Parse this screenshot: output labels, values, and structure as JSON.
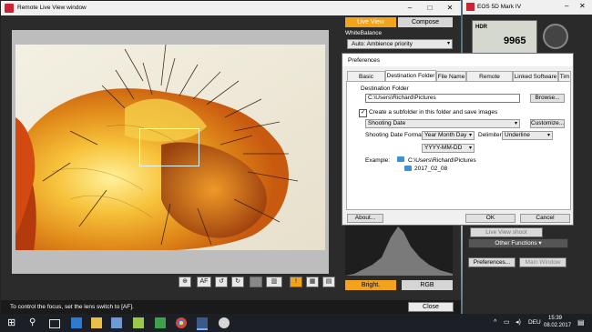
{
  "liveview": {
    "title": "Remote Live View window",
    "tab_liveview": "Live View",
    "tab_compose": "Compose",
    "whitebalance_label": "WhiteBalance",
    "whitebalance_value": "Auto: Ambience priority",
    "toolbar_labels": [
      "⊕",
      "AF",
      "↺",
      "↻",
      "",
      "▥",
      "!",
      "▦",
      "▤"
    ],
    "btn_bright": "Bright.",
    "btn_rgb": "RGB",
    "status_msg": "To control the focus, set the lens switch to [AF].",
    "close_label": "Close"
  },
  "eos": {
    "title": "EOS 5D Mark IV",
    "lcd_mode": "HDR",
    "lcd_value": "9965",
    "live_view_shoot": "Live View shoot",
    "other_functions": "Other Functions",
    "preferences_btn": "Preferences...",
    "main_window_btn": "Main Window"
  },
  "prefs": {
    "title": "Preferences",
    "tabs": [
      "Basic Settings",
      "Destination Folder",
      "File Name",
      "Remote Shooting",
      "Linked Software",
      "Tim"
    ],
    "dest_label": "Destination Folder",
    "dest_value": "C:\\Users\\Richard\\Pictures",
    "browse": "Browse...",
    "subfolder_check": "Create a subfolder in this folder and save images",
    "subfolder_value": "Shooting Date",
    "customize": "Customize...",
    "date_format_label": "Shooting Date Format",
    "date_format_value": "Year Month Day",
    "delimiter_label": "Delimiter",
    "delimiter_value": "Underline",
    "pattern_value": "YYYY-MM-DD",
    "example_label": "Example:",
    "example_path": "C:\\Users\\Richard\\Pictures",
    "example_folder": "2017_02_08",
    "about": "About...",
    "ok": "OK",
    "cancel": "Cancel"
  },
  "taskbar": {
    "time": "15:39",
    "date": "08.02.2017",
    "lang": "DEU"
  },
  "colors": {
    "accent_orange": "#f2a31b",
    "folder_blue": "#3d8fd6"
  }
}
